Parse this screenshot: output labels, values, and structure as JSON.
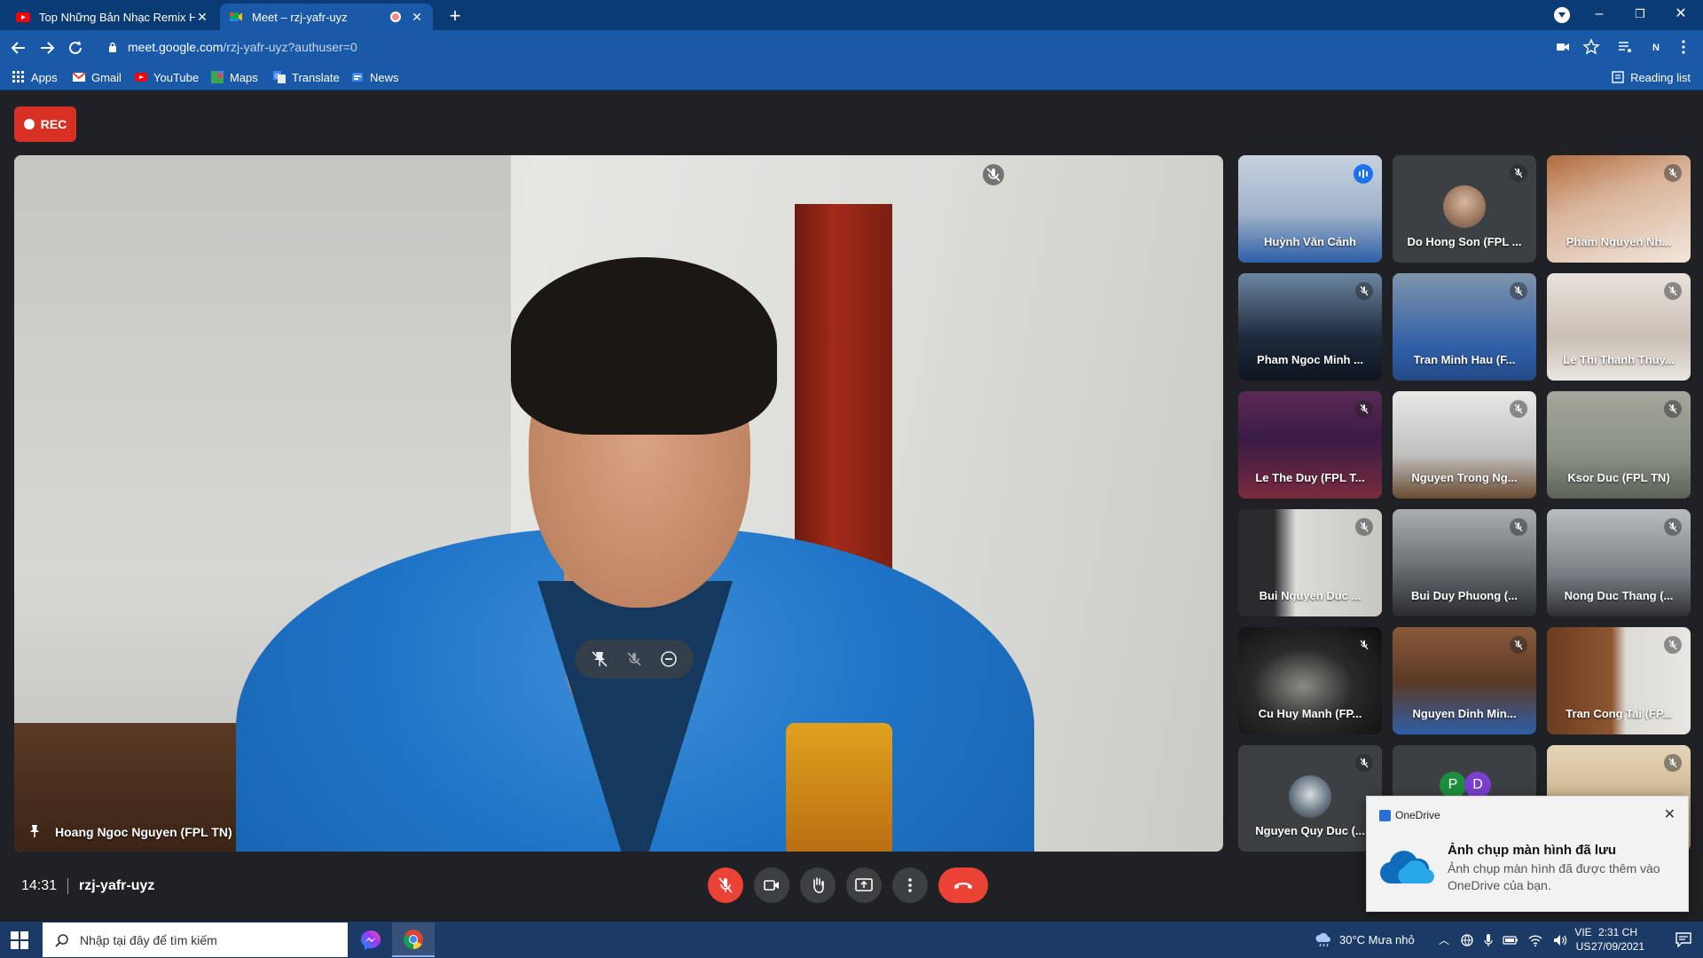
{
  "browser": {
    "tabs": [
      {
        "title": "Top Những Bản Nhạc Remix Hay",
        "close": "✕"
      },
      {
        "title": "Meet – rzj-yafr-uyz",
        "close": "✕"
      }
    ],
    "new_tab": "+",
    "url_host": "meet.google.com",
    "url_path": "/rzj-yafr-uyz?authuser=0",
    "profile_initial": "N",
    "window_controls": [
      "–",
      "❐",
      "✕"
    ]
  },
  "bookmarks": [
    {
      "label": "Apps",
      "icon": "apps-grid-icon"
    },
    {
      "label": "Gmail",
      "icon": "gmail-icon"
    },
    {
      "label": "YouTube",
      "icon": "youtube-icon"
    },
    {
      "label": "Maps",
      "icon": "maps-icon"
    },
    {
      "label": "Translate",
      "icon": "translate-icon"
    },
    {
      "label": "News",
      "icon": "news-icon"
    }
  ],
  "reading_list": "Reading list",
  "meet": {
    "rec_label": "REC",
    "main_speaker": "Hoang Ngoc Nguyen (FPL TN)",
    "tiles": [
      {
        "name": "Huỳnh Văn Cảnh",
        "state": "speaking"
      },
      {
        "name": "Do Hong Son (FPL ...",
        "state": "muted"
      },
      {
        "name": "Pham Nguyen Nh...",
        "state": "muted"
      },
      {
        "name": "Pham Ngoc Minh ...",
        "state": "muted"
      },
      {
        "name": "Tran Minh Hau (F...",
        "state": "muted"
      },
      {
        "name": "Le Thi Thanh Thuy...",
        "state": "muted"
      },
      {
        "name": "Le The Duy (FPL T...",
        "state": "muted"
      },
      {
        "name": "Nguyen Trong Ng...",
        "state": "muted"
      },
      {
        "name": "Ksor Duc (FPL TN)",
        "state": "muted"
      },
      {
        "name": "Bui Nguyen Duc ...",
        "state": "muted"
      },
      {
        "name": "Bui Duy Phuong (...",
        "state": "muted"
      },
      {
        "name": "Nong Duc Thang (...",
        "state": "muted"
      },
      {
        "name": "Cu Huy Manh (FP...",
        "state": "muted"
      },
      {
        "name": "Nguyen Dinh Min...",
        "state": "muted"
      },
      {
        "name": "Tran Cong Tai (FP...",
        "state": "muted"
      },
      {
        "name": "Nguyen Quy Duc (...",
        "state": "muted"
      },
      {
        "name": "",
        "state": "none"
      },
      {
        "name": "",
        "state": "muted"
      }
    ],
    "overflow_initials": [
      "P",
      "D"
    ],
    "time": "14:31",
    "meeting_code": "rzj-yafr-uyz"
  },
  "toast": {
    "app": "OneDrive",
    "title": "Ảnh chụp màn hình đã lưu",
    "body": "Ảnh chụp màn hình đã được thêm vào OneDrive của bạn.",
    "close": "✕"
  },
  "taskbar": {
    "search_placeholder": "Nhập tại đây để tìm kiếm",
    "weather": "30°C  Mưa nhỏ",
    "lang_line1": "VIE",
    "lang_line2": "US",
    "time": "2:31 CH",
    "date": "27/09/2021"
  },
  "colors": {
    "meet_bg": "#202124",
    "leave_red": "#ea4335",
    "speaking_blue": "#8ab4f8",
    "chrome_blue": "#1a58a8"
  }
}
